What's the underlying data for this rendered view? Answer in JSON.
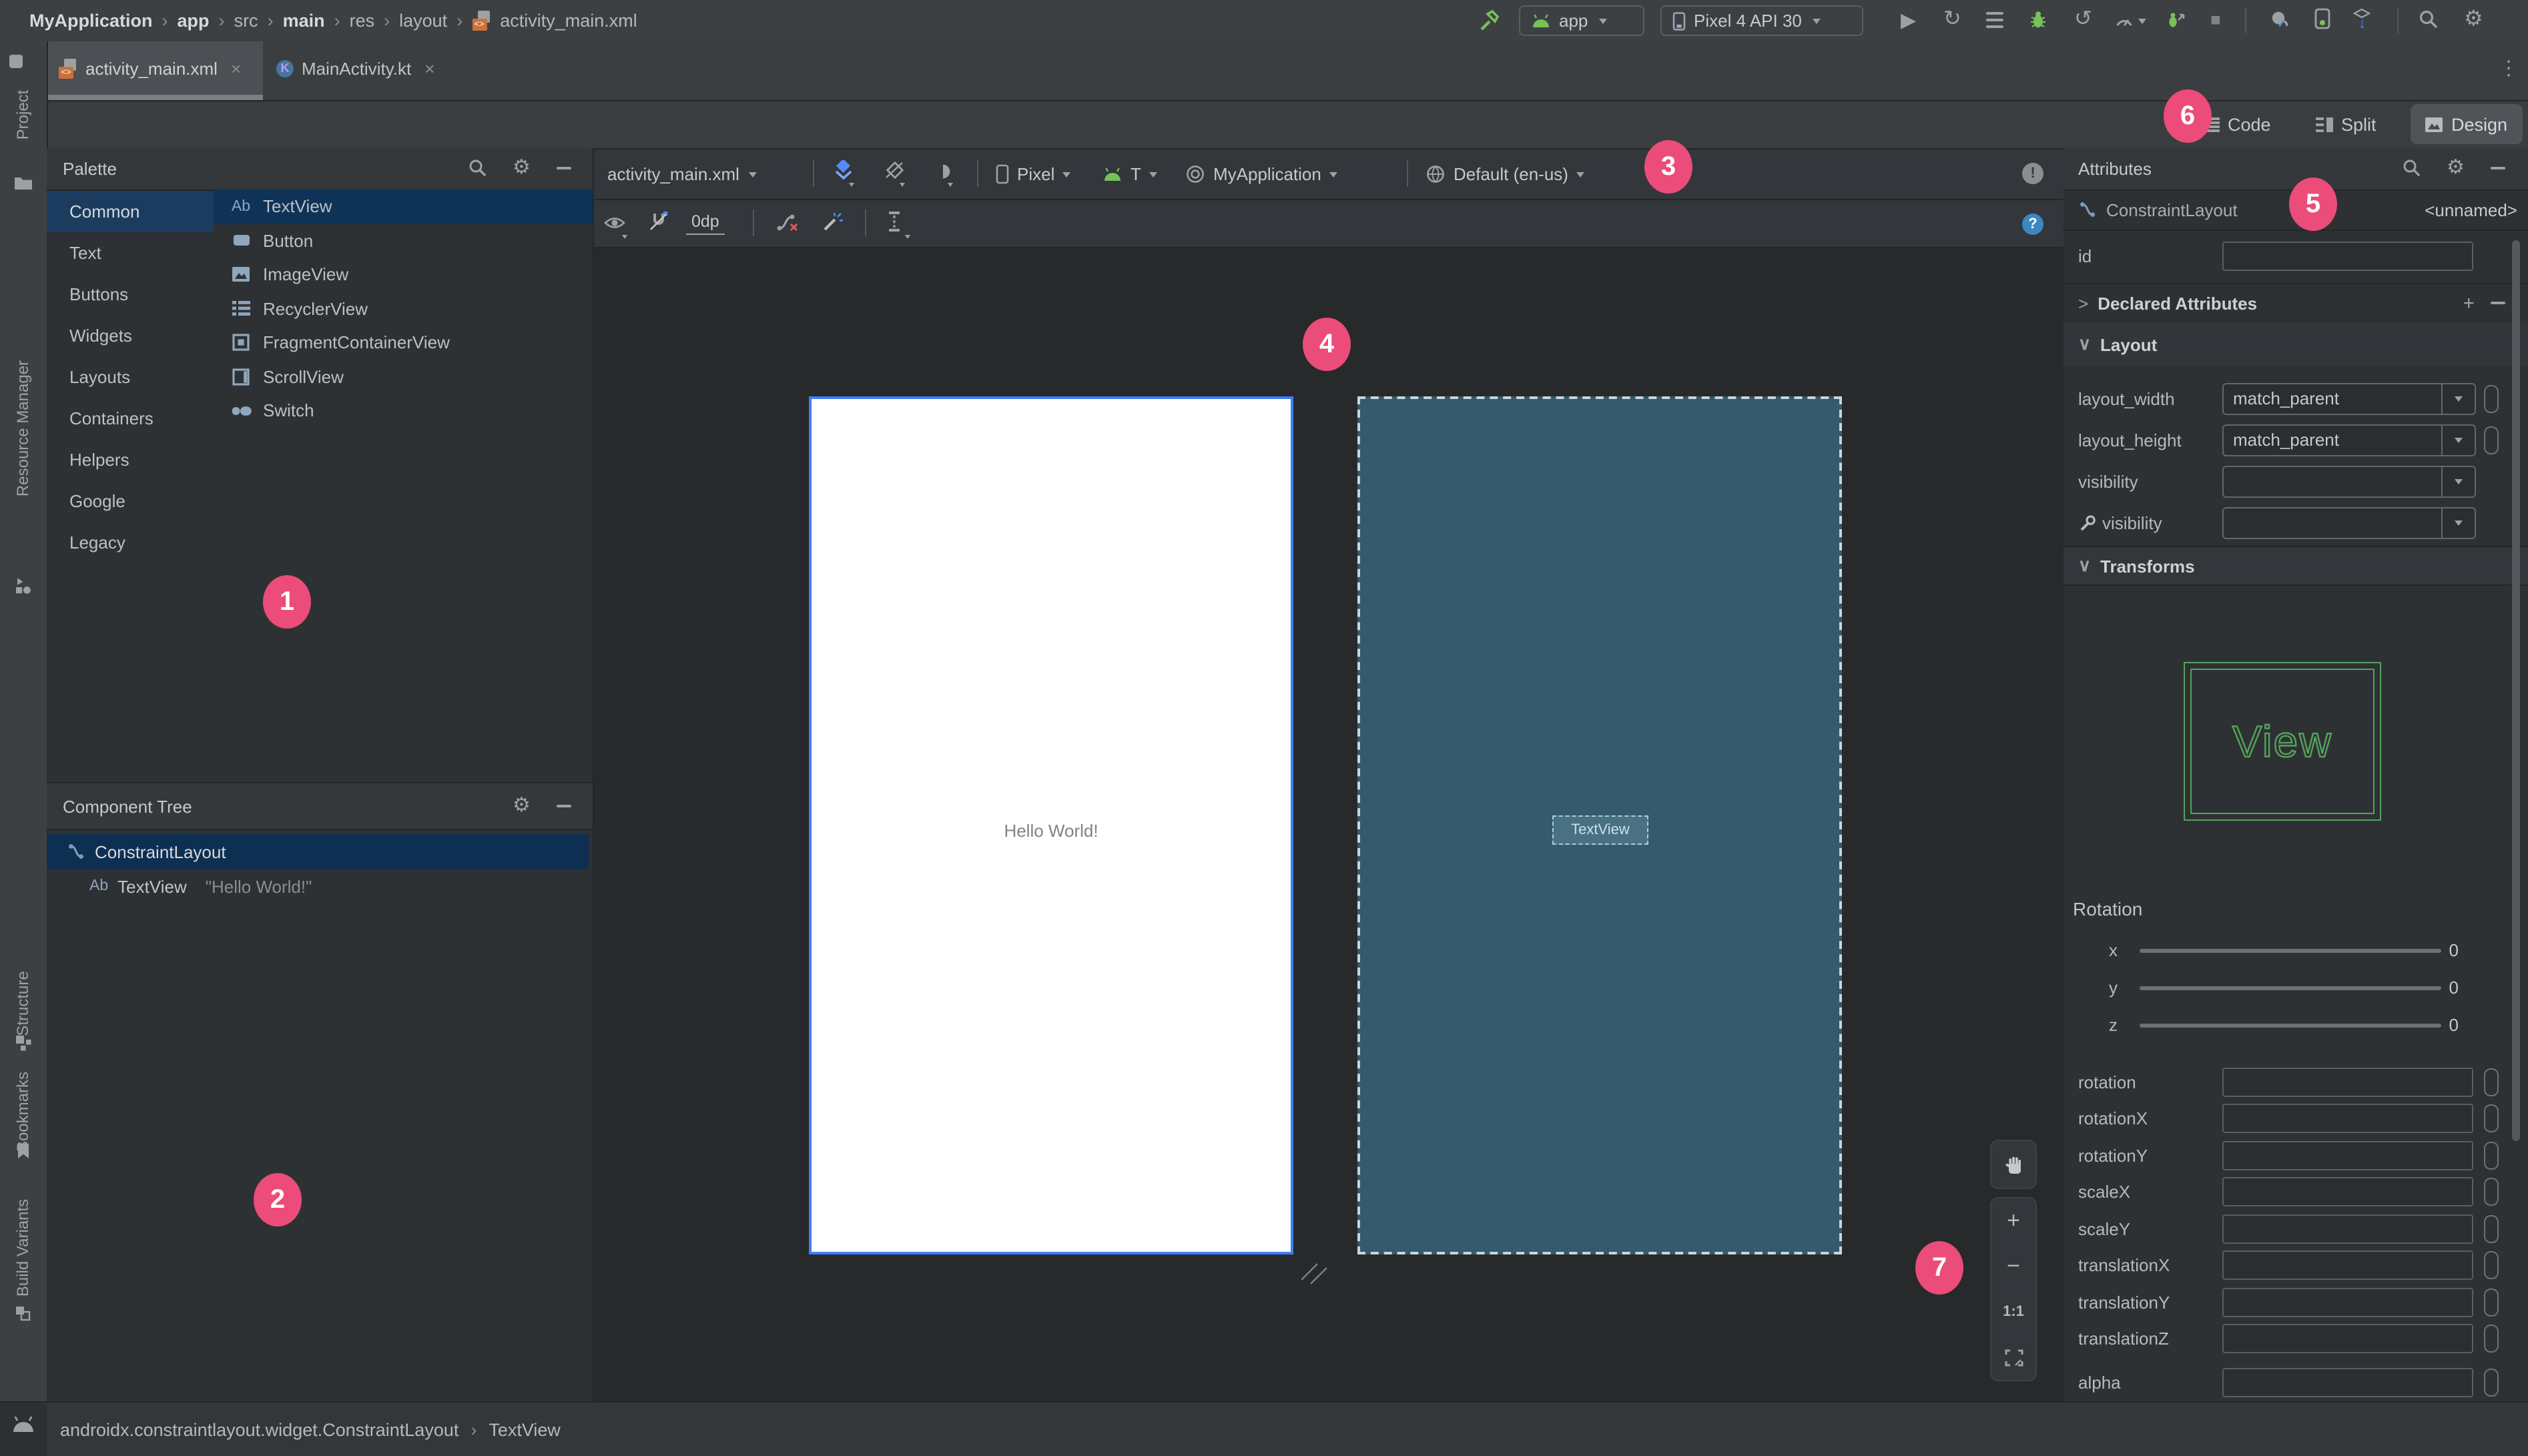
{
  "header": {
    "breadcrumb": [
      "MyApplication",
      "app",
      "src",
      "main",
      "res",
      "layout",
      "activity_main.xml"
    ],
    "run_config": "app",
    "device": "Pixel 4 API 30"
  },
  "tabs": {
    "tab1": "activity_main.xml",
    "tab2": "MainActivity.kt"
  },
  "mode": {
    "code": "Code",
    "split": "Split",
    "design": "Design"
  },
  "tool_windows": {
    "project": "Project",
    "resource_manager": "Resource Manager",
    "structure": "Structure",
    "bookmarks": "Bookmarks",
    "build_variants": "Build Variants"
  },
  "palette": {
    "title": "Palette",
    "categories": [
      "Common",
      "Text",
      "Buttons",
      "Widgets",
      "Layouts",
      "Containers",
      "Helpers",
      "Google",
      "Legacy"
    ],
    "items": [
      "TextView",
      "Button",
      "ImageView",
      "RecyclerView",
      "FragmentContainerView",
      "ScrollView",
      "Switch"
    ]
  },
  "component_tree": {
    "title": "Component Tree",
    "root": "ConstraintLayout",
    "child": "TextView",
    "child_text": "\"Hello World!\""
  },
  "design_toolbar": {
    "file": "activity_main.xml",
    "device": "Pixel",
    "api": "T",
    "theme": "MyApplication",
    "locale": "Default (en-us)",
    "margin": "0dp"
  },
  "canvas": {
    "design_text": "Hello World!",
    "blueprint_component": "TextView"
  },
  "zoom_controls": {
    "zoom_in": "+",
    "zoom_out": "−",
    "actual_size": "1:1"
  },
  "attributes": {
    "title": "Attributes",
    "component": "ConstraintLayout",
    "component_id": "<unnamed>",
    "id_label": "id",
    "declared": "Declared Attributes",
    "layout_section": "Layout",
    "transforms_section": "Transforms",
    "rows": {
      "layout_width": {
        "label": "layout_width",
        "value": "match_parent"
      },
      "layout_height": {
        "label": "layout_height",
        "value": "match_parent"
      },
      "visibility": {
        "label": "visibility"
      },
      "tools_visibility": {
        "label": "visibility"
      }
    },
    "view_label": "View",
    "rotation_label": "Rotation",
    "axes": [
      {
        "axis": "x",
        "value": "0"
      },
      {
        "axis": "y",
        "value": "0"
      },
      {
        "axis": "z",
        "value": "0"
      }
    ],
    "fields": [
      "rotation",
      "rotationX",
      "rotationY",
      "scaleX",
      "scaleY",
      "translationX",
      "translationY",
      "translationZ",
      "alpha"
    ]
  },
  "status_bar": {
    "path": "androidx.constraintlayout.widget.ConstraintLayout",
    "selected": "TextView"
  },
  "callouts": [
    "1",
    "2",
    "3",
    "4",
    "5",
    "6",
    "7"
  ],
  "ui": {
    "chevron": "›",
    "caret_down": "∨",
    "caret_right": ">",
    "close": "×",
    "xml_badge": "<>"
  },
  "icons": {
    "play": "▶",
    "stop": "■",
    "rerun": "↻",
    "undo": "↺",
    "gear": "⚙",
    "kebab": "⋮",
    "check": "✓",
    "arrow_down": "↓",
    "question": "?",
    "exclaim": "!",
    "plus": "+"
  },
  "colors": {
    "accent": "#EB4C79",
    "selection": "#0F3357",
    "blueprint_fill": "#35596D",
    "design_border": "#3E7EF7",
    "wireframe_green": "#53A35A"
  }
}
